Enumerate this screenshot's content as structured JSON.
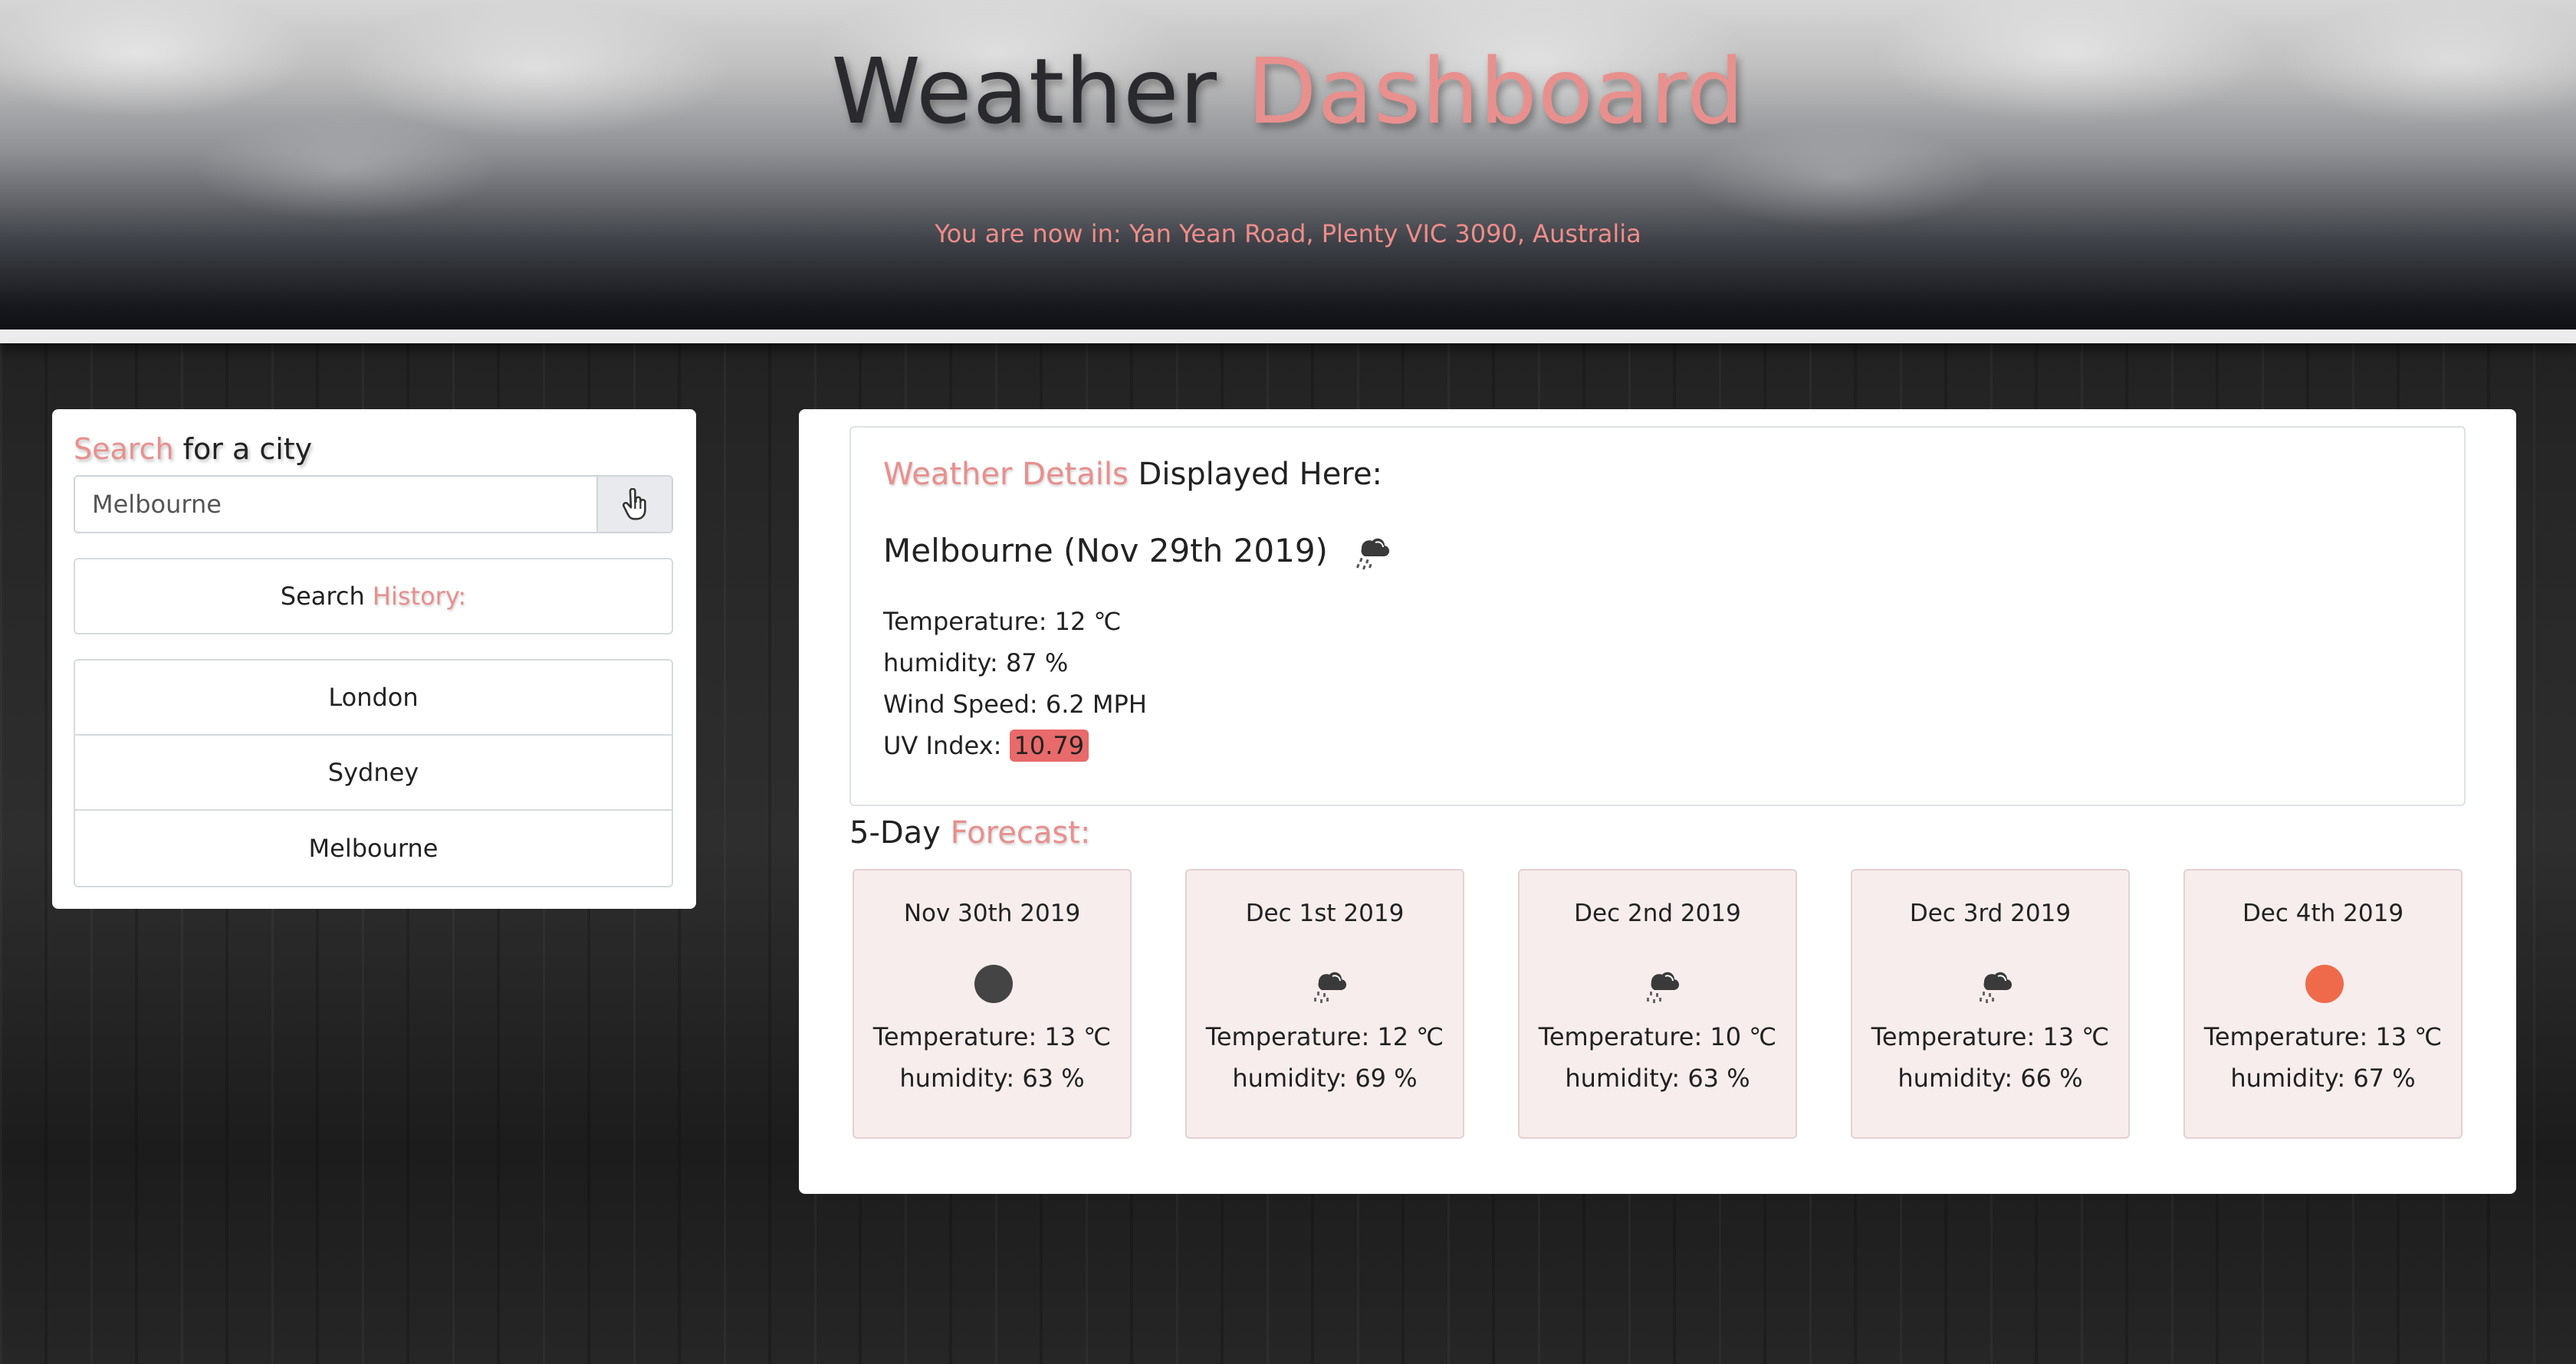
{
  "header": {
    "title_main": "Weather",
    "title_accent": "Dashboard",
    "location": "You are now in: Yan Yean Road, Plenty VIC 3090, Australia"
  },
  "search": {
    "title_accent": "Search",
    "title_rest": " for a city",
    "input_value": "Melbourne",
    "button_icon": "pointer-hand-icon",
    "history_label_main": "Search ",
    "history_label_accent": "History:",
    "history": [
      "London",
      "Sydney",
      "Melbourne"
    ]
  },
  "details": {
    "heading_accent": "Weather Details",
    "heading_rest": " Displayed Here:",
    "city_line": "Melbourne (Nov 29th 2019)",
    "icon": "rain-cloud-icon",
    "temperature": "Temperature: 12 ℃",
    "humidity": "humidity: 87 %",
    "wind": "Wind Speed: 6.2 MPH",
    "uv_label": "UV Index: ",
    "uv_value": "10.79"
  },
  "forecast": {
    "heading_main": "5-Day ",
    "heading_accent": "Forecast:",
    "days": [
      {
        "date": "Nov 30th 2019",
        "icon": "dark-circle-icon",
        "temp": "Temperature: 13 ℃",
        "humidity": "humidity: 63 %"
      },
      {
        "date": "Dec 1st 2019",
        "icon": "rain-cloud-icon",
        "temp": "Temperature: 12 ℃",
        "humidity": "humidity: 69 %"
      },
      {
        "date": "Dec 2nd 2019",
        "icon": "rain-cloud-icon",
        "temp": "Temperature: 10 ℃",
        "humidity": "humidity: 63 %"
      },
      {
        "date": "Dec 3rd 2019",
        "icon": "rain-cloud-icon",
        "temp": "Temperature: 13 ℃",
        "humidity": "humidity: 66 %"
      },
      {
        "date": "Dec 4th 2019",
        "icon": "sun-circle-icon",
        "temp": "Temperature: 13 ℃",
        "humidity": "humidity: 67 %"
      }
    ]
  },
  "colors": {
    "accent": "#e8908e",
    "uv_high": "#e86a6a",
    "sun": "#ef6a4a",
    "dark_circle": "#444444"
  }
}
